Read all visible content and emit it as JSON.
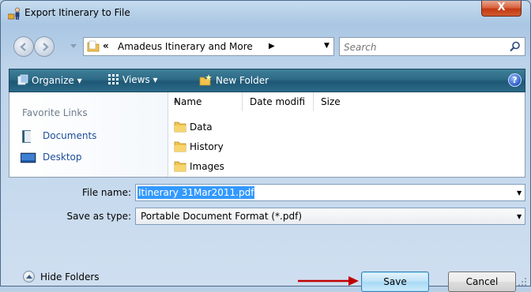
{
  "window": {
    "title": "Export Itinerary to File",
    "close_label": "X"
  },
  "address": {
    "breadcrumb_prefix": "«",
    "path": "Amadeus Itinerary and More",
    "path_arrow": "▶"
  },
  "search": {
    "placeholder": "Search"
  },
  "toolbar": {
    "organize_label": "Organize ▾",
    "views_label": "Views ▾",
    "new_folder_label": "New Folder",
    "help_label": "?"
  },
  "favorites": {
    "title": "Favorite Links",
    "items": [
      {
        "label": "Documents",
        "icon": "documents-icon"
      },
      {
        "label": "Desktop",
        "icon": "desktop-icon"
      }
    ]
  },
  "file_list": {
    "columns": [
      "Name",
      "Date modifi",
      "Size"
    ],
    "rows": [
      {
        "name": "Data",
        "icon": "folder-icon"
      },
      {
        "name": "History",
        "icon": "folder-icon"
      },
      {
        "name": "Images",
        "icon": "folder-icon"
      }
    ]
  },
  "form": {
    "file_name_label": "File name:",
    "file_name_value": "Itinerary 31Mar2011.pdf",
    "save_type_label": "Save as type:",
    "save_type_value": "Portable Document Format (*.pdf)"
  },
  "footer": {
    "hide_folders_label": "Hide Folders",
    "save_label": "Save",
    "cancel_label": "Cancel"
  },
  "colors": {
    "toolbar": "#2d6a86",
    "annotation_arrow": "#c00000",
    "selection": "#3399ff"
  }
}
